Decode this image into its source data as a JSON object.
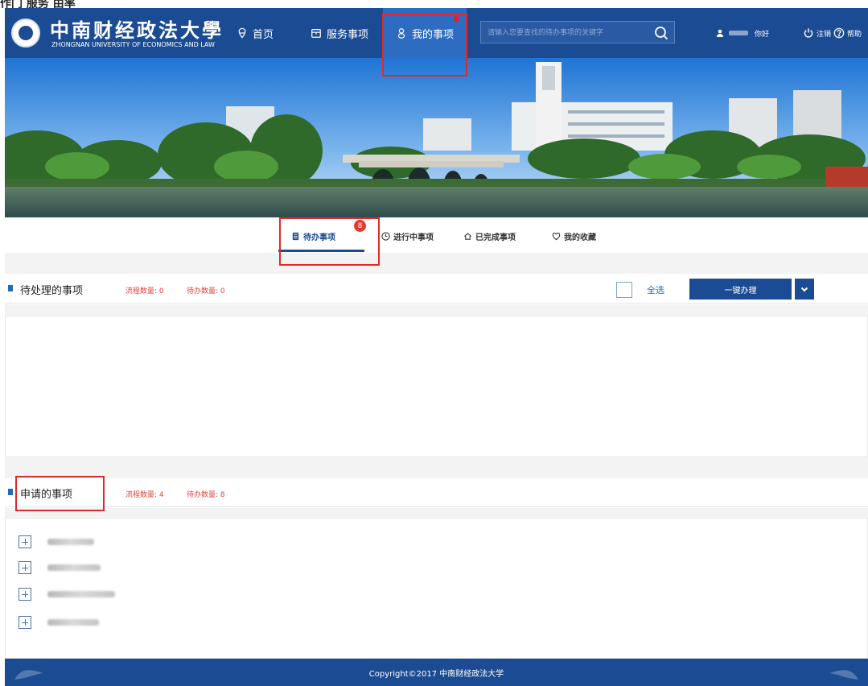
{
  "top_cut_text": "作门 服务 由率",
  "header": {
    "logo_cn": "中南财经政法大學",
    "logo_en": "ZHONGNAN UNIVERSITY OF ECONOMICS AND LAW",
    "nav": [
      {
        "label": "首页",
        "icon": "location-pin-icon"
      },
      {
        "label": "服务事项",
        "icon": "calendar-icon"
      },
      {
        "label": "我的事项",
        "icon": "person-icon",
        "active": true
      }
    ],
    "search_placeholder": "请输入您要查找的待办事项的关键字",
    "greeting": "你好",
    "logout_label": "注销",
    "help_label": "帮助"
  },
  "tabs": [
    {
      "label": "待办事项",
      "icon": "document-icon",
      "badge": "8",
      "active": true
    },
    {
      "label": "进行中事项",
      "icon": "clock-icon"
    },
    {
      "label": "已完成事项",
      "icon": "home-icon"
    },
    {
      "label": "我的收藏",
      "icon": "heart-icon"
    }
  ],
  "pending_section": {
    "title": "待处理的事项",
    "flow_count_label": "流程数量: 0",
    "todo_count_label": "待办数量: 0",
    "select_all_label": "全选",
    "bulk_button_label": "一键办理"
  },
  "applied_section": {
    "title": "申请的事项",
    "flow_count_label": "流程数量: 4",
    "todo_count_label": "待办数量: 8",
    "items": [
      {
        "blur_width_fraction": 0.6
      },
      {
        "blur_width_fraction": 0.7
      },
      {
        "blur_width_fraction": 0.9
      },
      {
        "blur_width_fraction": 0.65
      }
    ]
  },
  "footer": {
    "copyright": "Copyright©2017 中南财经政法大学"
  },
  "colors": {
    "brand": "#1b4c93",
    "active_nav": "#2e6cc2",
    "alert": "#e02a2a",
    "stat_red": "#e0443a"
  }
}
